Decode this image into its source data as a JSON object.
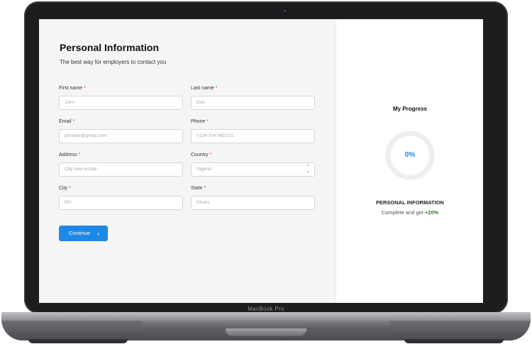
{
  "device": {
    "label": "MacBook Pro"
  },
  "form": {
    "title": "Personal Information",
    "subtitle": "The best way for employers to contact you",
    "required_mark": "*",
    "fields": {
      "first_name": {
        "label": "First name",
        "placeholder": "John"
      },
      "last_name": {
        "label": "Last name",
        "placeholder": "Doe"
      },
      "email": {
        "label": "Email",
        "placeholder": "johndoe@gmail.com"
      },
      "phone": {
        "label": "Phone",
        "placeholder": "+234 7047482101"
      },
      "address": {
        "label": "Address",
        "placeholder": "City view estate"
      },
      "country": {
        "label": "Country",
        "value": "Nigeria"
      },
      "city": {
        "label": "City",
        "placeholder": "PH"
      },
      "state": {
        "label": "State",
        "placeholder": "Rivers"
      }
    },
    "continue_label": "Continue",
    "continue_icon": "chevron-right-icon"
  },
  "progress": {
    "title": "My Progress",
    "percent": 0,
    "percent_label": "0%",
    "section_title": "PERSONAL INFORMATION",
    "cta_text": "Complete and get",
    "bonus": "+20%",
    "accent_color": "#1e88e5",
    "bonus_color": "#2e7d32"
  }
}
